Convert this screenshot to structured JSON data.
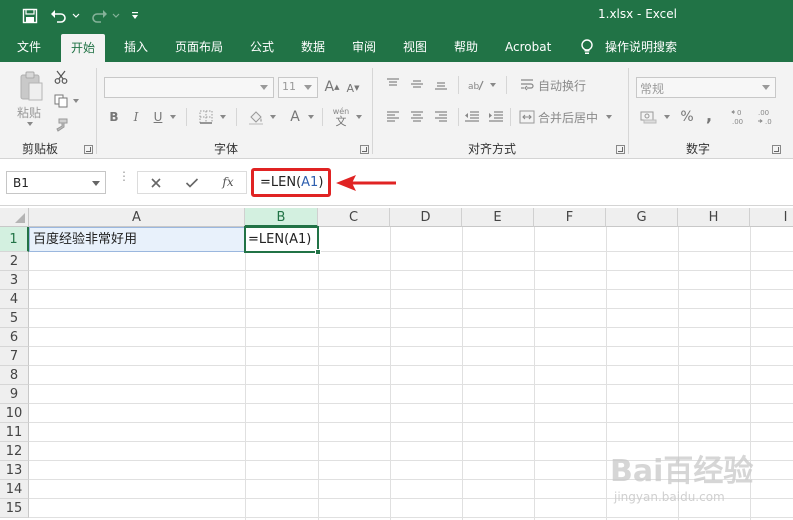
{
  "window": {
    "title": "1.xlsx  -  Excel",
    "accent_color": "#217346"
  },
  "quick_access": {
    "save_icon": "save-icon",
    "undo_icon": "undo-icon",
    "redo_icon": "redo-icon",
    "customize_icon": "customize-qat-icon"
  },
  "tabs": [
    {
      "label": "文件"
    },
    {
      "label": "开始",
      "active": true
    },
    {
      "label": "插入"
    },
    {
      "label": "页面布局"
    },
    {
      "label": "公式"
    },
    {
      "label": "数据"
    },
    {
      "label": "审阅"
    },
    {
      "label": "视图"
    },
    {
      "label": "帮助"
    },
    {
      "label": "Acrobat"
    }
  ],
  "tell_me": {
    "label": "操作说明搜索",
    "icon": "lightbulb-icon"
  },
  "ribbon": {
    "clipboard": {
      "label": "剪贴板",
      "paste_label": "粘贴"
    },
    "font": {
      "label": "字体",
      "font_name": "",
      "font_size": "11",
      "bold": "B",
      "italic": "I",
      "underline": "U",
      "font_color_letter": "A",
      "grow_font": "A",
      "shrink_font": "A",
      "phonetic_top": "wén",
      "phonetic_bottom": "文"
    },
    "alignment": {
      "label": "对齐方式",
      "wrap_text": "自动换行",
      "merge_center": "合并后居中"
    },
    "number": {
      "label": "数字",
      "format": "常规",
      "percent": "%",
      "comma": ","
    }
  },
  "formula_bar": {
    "name_box": "B1",
    "cancel_icon": "cancel-icon",
    "enter_icon": "checkmark-icon",
    "fx_label": "fx",
    "formula_prefix": "=LEN(",
    "formula_ref": "A1",
    "formula_suffix": ")"
  },
  "sheet": {
    "columns": [
      "A",
      "B",
      "C",
      "D",
      "E",
      "F",
      "G",
      "H",
      "I"
    ],
    "selected_column": "B",
    "rows": [
      "1",
      "2",
      "3",
      "4",
      "5",
      "6",
      "7",
      "8",
      "9",
      "10",
      "11",
      "12",
      "13",
      "14",
      "15"
    ],
    "selected_row": "1",
    "cells": {
      "A1": "百度经验非常好用",
      "B1": "=LEN(A1)"
    }
  },
  "watermark": {
    "brand": "Bai百经验",
    "url": "jingyan.baidu.com"
  }
}
